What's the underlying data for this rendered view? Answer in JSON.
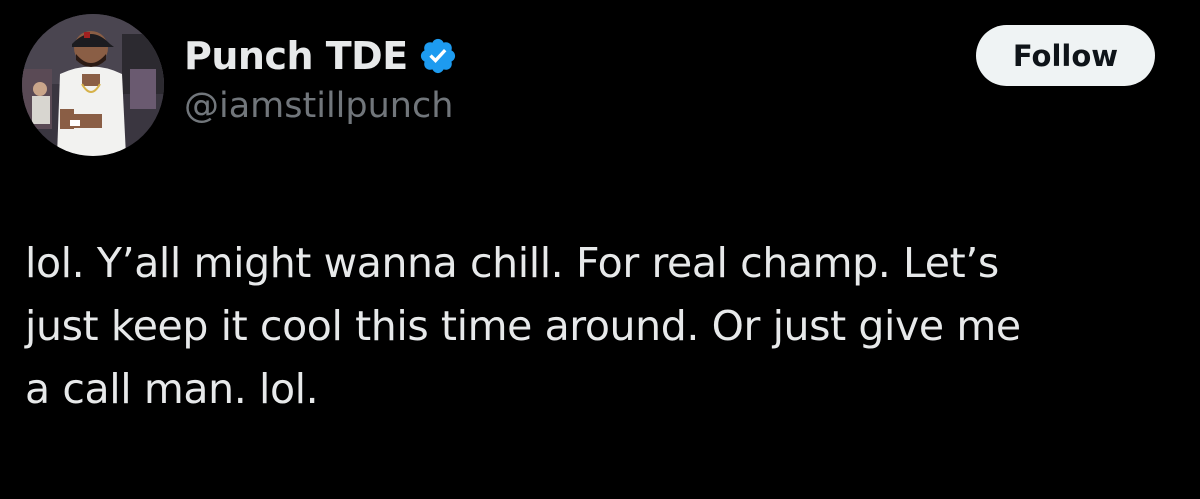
{
  "author": {
    "display_name": "Punch TDE",
    "handle": "@iamstillpunch",
    "verified_icon": "verified-badge-icon",
    "avatar_icon": "profile-photo"
  },
  "actions": {
    "follow_label": "Follow"
  },
  "tweet": {
    "text_lines": [
      "lol. Y’all might wanna chill. For real champ. Let’s",
      "just keep it cool this time around. Or just give me",
      "a call man. lol."
    ]
  },
  "colors": {
    "background": "#000000",
    "primary_text": "#e7e9ea",
    "secondary_text": "#71767b",
    "verified_blue": "#1d9bf0",
    "follow_button_bg": "#eff3f4",
    "follow_button_text": "#0f1419"
  }
}
